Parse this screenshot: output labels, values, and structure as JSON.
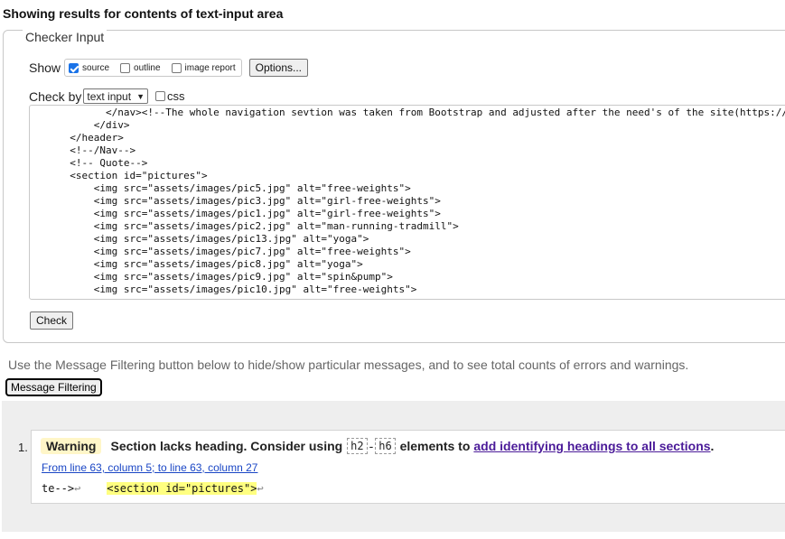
{
  "heading": "Showing results for contents of text-input area",
  "checker": {
    "legend": "Checker Input",
    "show_label": "Show",
    "show_options": [
      {
        "label": "source",
        "checked": true
      },
      {
        "label": "outline",
        "checked": false
      },
      {
        "label": "image report",
        "checked": false
      }
    ],
    "options_button": "Options...",
    "check_by_label": "Check by",
    "check_by_value": "text input",
    "css_label": "css",
    "css_checked": false,
    "code_lines": [
      "        </nav><!--The whole navigation sevtion was taken from Bootstrap and adjusted after the need's of the site(https://",
      "      </div>",
      "  </header>",
      "  <!--/Nav-->",
      "  <!-- Quote-->",
      "  <section id=\"pictures\">",
      "      <img src=\"assets/images/pic5.jpg\" alt=\"free-weights\">",
      "      <img src=\"assets/images/pic3.jpg\" alt=\"girl-free-weights\">",
      "      <img src=\"assets/images/pic1.jpg\" alt=\"girl-free-weights\">",
      "      <img src=\"assets/images/pic2.jpg\" alt=\"man-running-tradmill\">",
      "      <img src=\"assets/images/pic13.jpg\" alt=\"yoga\">",
      "      <img src=\"assets/images/pic7.jpg\" alt=\"free-weights\">",
      "      <img src=\"assets/images/pic8.jpg\" alt=\"yoga\">",
      "      <img src=\"assets/images/pic9.jpg\" alt=\"spin&pump\">",
      "      <img src=\"assets/images/pic10.jpg\" alt=\"free-weights\">"
    ],
    "check_button": "Check"
  },
  "filter": {
    "instructions": "Use the Message Filtering button below to hide/show particular messages, and to see total counts of errors and warnings.",
    "button": "Message Filtering"
  },
  "messages": [
    {
      "number": "1.",
      "type": "Warning",
      "text_before": "Section lacks heading. Consider using",
      "chip1": "h2",
      "dash": "-",
      "chip2": "h6",
      "text_middle": "elements to",
      "link": "add identifying headings to all sections",
      "text_after": ".",
      "location": "From line 63, column 5; to line 63, column 27",
      "extract_before": "te-->",
      "extract_ret1": "↩",
      "extract_gap": "    ",
      "extract_highlight": "<section id=\"pictures\">",
      "extract_ret2": "↩"
    }
  ],
  "colors": {
    "warning_bg": "#fff6c8",
    "link_visited": "#4b1b99",
    "link": "#1a46c5",
    "highlight": "#ffff80"
  }
}
